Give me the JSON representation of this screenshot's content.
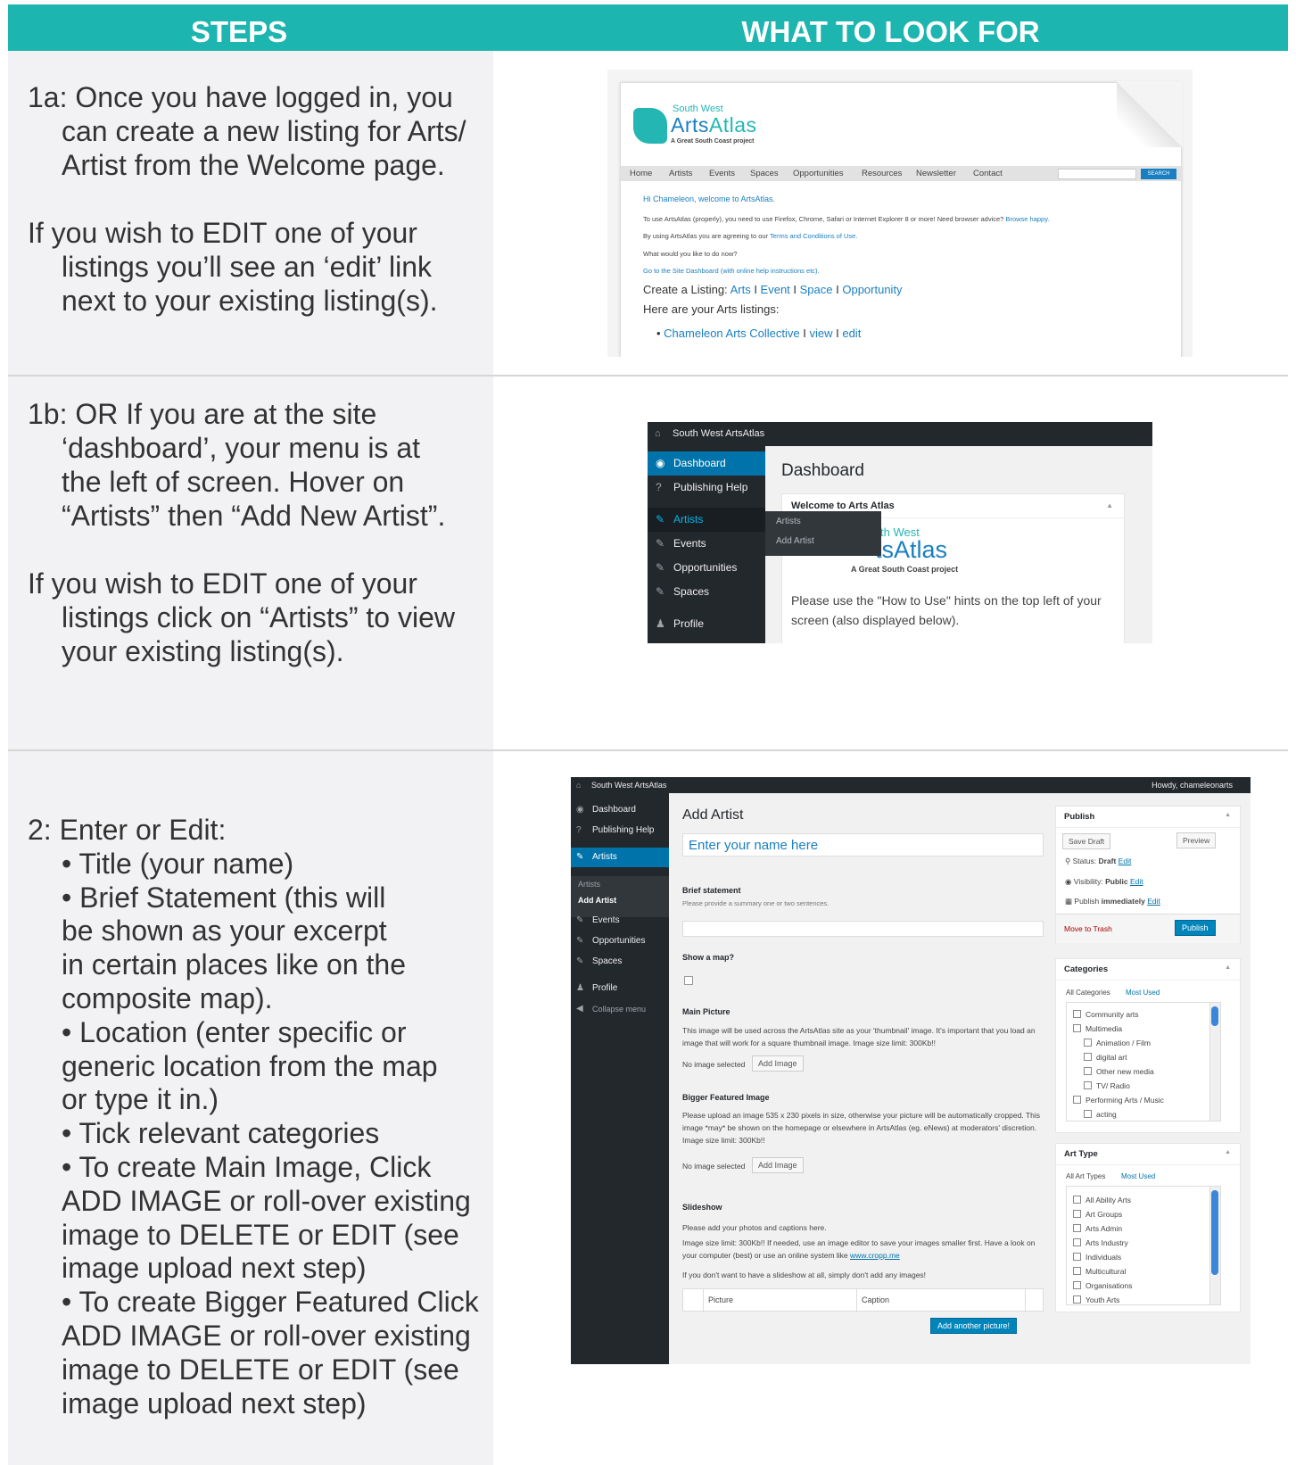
{
  "header": {
    "steps": "STEPS",
    "look": "WHAT TO LOOK FOR"
  },
  "step1": {
    "p1": [
      "1a: Once you have logged in, you",
      "can create a new listing for Arts/",
      "Artist from the Welcome page."
    ],
    "p2": [
      "If you wish to EDIT one of your",
      "listings you’ll see an ‘edit’ link",
      "next to your existing listing(s)."
    ]
  },
  "step2": {
    "p1": [
      "1b: OR If you are at the site",
      "‘dashboard’, your menu is at",
      "the left of screen. Hover on",
      "“Artists” then “Add New Artist”."
    ],
    "p2": [
      "If you wish to EDIT one of your",
      "listings click on “Artists” to view",
      "your existing listing(s)."
    ]
  },
  "step3": {
    "heading": "2: Enter or Edit:",
    "lines": [
      "• Title (your name)",
      "• Brief Statement (this will",
      "be shown as your excerpt",
      "in certain places like on the",
      "composite map).",
      "• Location (enter specific or",
      "generic location from the map",
      "or type it in.)",
      "• Tick relevant categories",
      "• To create Main Image, Click",
      "ADD IMAGE or roll-over existing",
      "image to DELETE or EDIT (see",
      "image upload next step)",
      "• To create Bigger Featured Click",
      "ADD IMAGE or roll-over existing",
      "image to DELETE or EDIT (see",
      "image upload next step)"
    ]
  },
  "shot1": {
    "brand_small": "South West",
    "brand_a": "Arts",
    "brand_b": "Atlas",
    "tagline": "A Great South Coast project",
    "nav": [
      "Home",
      "Artists",
      "Events",
      "Spaces",
      "Opportunities",
      "Resources",
      "Newsletter",
      "Contact"
    ],
    "search_btn": "SEARCH",
    "welcome": "Hi Chameleon, welcome to ArtsAtlas.",
    "browser_text": "To use ArtsAtlas (properly), you need to use Firefox, Chrome, Safari or Internet Explorer 8 or more! Need browser advice?",
    "browser_link": "Browse happy.",
    "terms_text": "By using ArtsAtlas you are agreeing to our",
    "terms_link": "Terms and Conditions of Use.",
    "what_next": "What would you like to do now?",
    "dash_link": "Go to the Site Dashboard (with online help instructions etc).",
    "create_label": "Create a Listing:",
    "create_links": [
      "Arts",
      "Event",
      "Space",
      "Opportunity"
    ],
    "listings_label": "Here are your Arts listings:",
    "listing_name": "Chameleon Arts Collective",
    "listing_view": "view",
    "listing_edit": "edit"
  },
  "shot2": {
    "site": "South West ArtsAtlas",
    "menu": [
      "Dashboard",
      "Publishing Help",
      "Artists",
      "Events",
      "Opportunities",
      "Spaces",
      "Profile"
    ],
    "flyout": [
      "Artists",
      "Add Artist"
    ],
    "title": "Dashboard",
    "panel_title": "Welcome to Arts Atlas",
    "brand_small": "th West",
    "brand_big": "tsAtlas",
    "tagline": "A Great South Coast project",
    "hint": "Please use the \"How to Use\" hints on the top left of your screen (also displayed below)."
  },
  "shot3": {
    "site": "South West ArtsAtlas",
    "howdy": "Howdy, chameleonarts",
    "menu": [
      "Dashboard",
      "Publishing Help",
      "Artists",
      "Events",
      "Opportunities",
      "Spaces",
      "Profile",
      "Collapse menu"
    ],
    "submenu": [
      "Artists",
      "Add Artist"
    ],
    "title": "Add Artist",
    "name_placeholder": "Enter your name here",
    "brief_label": "Brief statement",
    "brief_hint": "Please provide a summary one or two sentences.",
    "map_label": "Show a map?",
    "main_pic_label": "Main Picture",
    "main_pic_text": "This image will be used across the ArtsAtlas site as your 'thumbnail' image. It's important that you load an image that will work for a square thumbnail image. Image size limit: 300Kb!!",
    "no_image": "No image selected",
    "add_image": "Add Image",
    "bigger_label": "Bigger Featured Image",
    "bigger_text": "Please upload an image 535 x 230 pixels in size, otherwise your picture will be automatically cropped. This image *may* be shown on the homepage or elsewhere in ArtsAtlas (eg. eNews) at moderators' discretion. Image size limit: 300Kb!!",
    "slideshow_label": "Slideshow",
    "slideshow_text1": "Please add your photos and captions here.",
    "slideshow_text2": "Image size limit: 300Kb!! If needed, use an image editor to save your images smaller first. Have a look on your computer (best) or use an online system like",
    "slideshow_link": "www.cropp.me",
    "slideshow_text3": "If you don't want to have a slideshow at all, simply don't add any images!",
    "col_picture": "Picture",
    "col_caption": "Caption",
    "add_picture": "Add another picture!",
    "publish": {
      "title": "Publish",
      "save_draft": "Save Draft",
      "preview": "Preview",
      "status": "Status:",
      "status_val": "Draft",
      "visibility": "Visibility:",
      "visibility_val": "Public",
      "publish_when": "Publish",
      "publish_when_val": "immediately",
      "edit": "Edit",
      "trash": "Move to Trash",
      "publish_btn": "Publish"
    },
    "categories": {
      "title": "Categories",
      "tab_all": "All Categories",
      "tab_used": "Most Used",
      "items": [
        "Community arts",
        "Multimedia",
        "Animation / Film",
        "digital art",
        "Other new media",
        "TV/ Radio",
        "Performing Arts / Music",
        "acting"
      ]
    },
    "arttype": {
      "title": "Art Type",
      "tab_all": "All Art Types",
      "tab_used": "Most Used",
      "items": [
        "All Ability Arts",
        "Art Groups",
        "Arts Admin",
        "Arts Industry",
        "Individuals",
        "Multicultural",
        "Organisations",
        "Youth Arts"
      ]
    }
  }
}
